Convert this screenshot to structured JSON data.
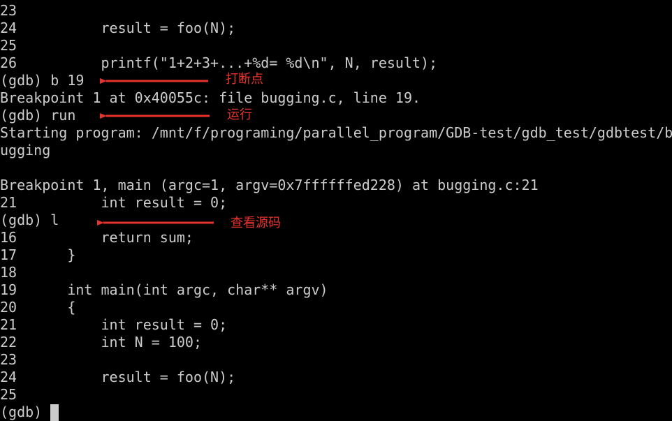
{
  "terminal": {
    "lines": [
      "23",
      "24          result = foo(N);",
      "25",
      "26          printf(\"1+2+3+...+%d= %d\\n\", N, result);",
      "(gdb) b 19",
      "Breakpoint 1 at 0x40055c: file bugging.c, line 19.",
      "(gdb) run",
      "Starting program: /mnt/f/programing/parallel_program/GDB-test/gdb_test/gdbtest/b",
      "ugging",
      "",
      "Breakpoint 1, main (argc=1, argv=0x7ffffffed228) at bugging.c:21",
      "21          int result = 0;",
      "(gdb) l",
      "16          return sum;",
      "17      }",
      "18",
      "19      int main(int argc, char** argv)",
      "20      {",
      "21          int result = 0;",
      "22          int N = 100;",
      "23",
      "24          result = foo(N);",
      "25"
    ],
    "prompt": "(gdb) "
  },
  "annotations": {
    "breakpoint": "打断点",
    "run": "运行",
    "list": "查看源码",
    "color": "#e8332a"
  },
  "colors": {
    "background": "#000000",
    "text": "#cccccc"
  }
}
